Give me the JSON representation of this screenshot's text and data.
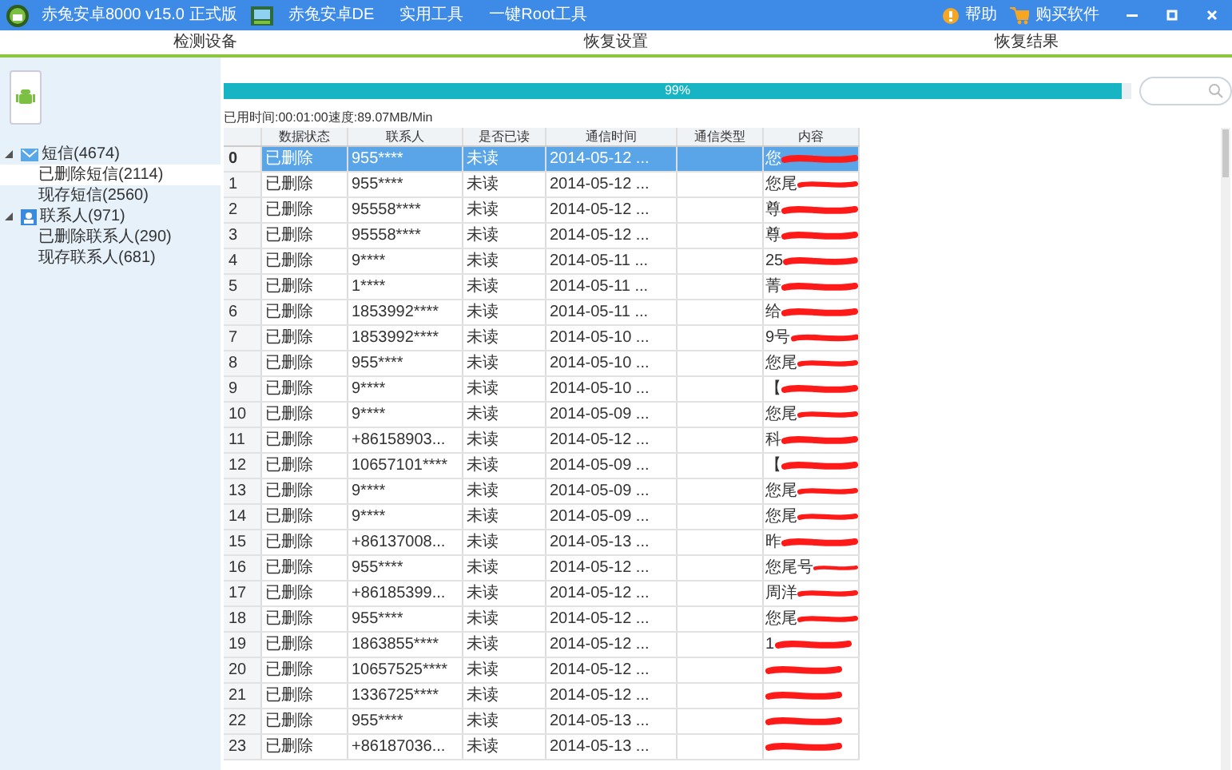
{
  "title_bar": {
    "app_title": "赤兔安卓8000 v15.0 正式版",
    "menu": [
      "赤兔安卓DE",
      "实用工具",
      "一键Root工具"
    ],
    "help": "帮助",
    "buy": "购买软件"
  },
  "tabs": [
    {
      "label": "检测设备",
      "selected": false
    },
    {
      "label": "恢复设置",
      "selected": false
    },
    {
      "label": "恢复结果",
      "selected": false
    }
  ],
  "sidebar": {
    "tree": [
      {
        "label": "短信(4674)",
        "kind": "sms",
        "expanded": true,
        "selected": false,
        "children": [
          {
            "label": "已删除短信(2114)",
            "selected": true
          },
          {
            "label": "现存短信(2560)",
            "selected": false
          }
        ]
      },
      {
        "label": "联系人(971)",
        "kind": "contacts",
        "expanded": true,
        "selected": false,
        "children": [
          {
            "label": "已删除联系人(290)",
            "selected": false
          },
          {
            "label": "现存联系人(681)",
            "selected": false
          }
        ]
      }
    ]
  },
  "progress": {
    "level": 0.99,
    "label": "99%"
  },
  "status_text": "已用时间:00:01:00速度:89.07MB/Min",
  "table": {
    "columns": [
      "数据状态",
      "联系人",
      "是否已读",
      "通信时间",
      "通信类型",
      "内容"
    ],
    "rows": [
      {
        "index": "0",
        "status": "已删除",
        "contact": "955****",
        "read": "未读",
        "time": "2014-05-12 ...",
        "content": "您",
        "selected": true
      },
      {
        "index": "1",
        "status": "已删除",
        "contact": "955****",
        "read": "未读",
        "time": "2014-05-12 ...",
        "content": "您尾",
        "selected": false
      },
      {
        "index": "2",
        "status": "已删除",
        "contact": "95558****",
        "read": "未读",
        "time": "2014-05-12 ...",
        "content": "尊",
        "selected": false
      },
      {
        "index": "3",
        "status": "已删除",
        "contact": "95558****",
        "read": "未读",
        "time": "2014-05-12 ...",
        "content": "尊",
        "selected": false
      },
      {
        "index": "4",
        "status": "已删除",
        "contact": "9****",
        "read": "未读",
        "time": "2014-05-11 ...",
        "content": "25",
        "selected": false
      },
      {
        "index": "5",
        "status": "已删除",
        "contact": "1****",
        "read": "未读",
        "time": "2014-05-11 ...",
        "content": "菁",
        "selected": false
      },
      {
        "index": "6",
        "status": "已删除",
        "contact": "1853992****",
        "read": "未读",
        "time": "2014-05-11 ...",
        "content": "给",
        "selected": false
      },
      {
        "index": "7",
        "status": "已删除",
        "contact": "1853992****",
        "read": "未读",
        "time": "2014-05-10 ...",
        "content": "9号",
        "selected": false
      },
      {
        "index": "8",
        "status": "已删除",
        "contact": "955****",
        "read": "未读",
        "time": "2014-05-10 ...",
        "content": "您尾",
        "selected": false
      },
      {
        "index": "9",
        "status": "已删除",
        "contact": "9****",
        "read": "未读",
        "time": "2014-05-10 ...",
        "content": "【",
        "selected": false
      },
      {
        "index": "10",
        "status": "已删除",
        "contact": "9****",
        "read": "未读",
        "time": "2014-05-09 ...",
        "content": "您尾",
        "selected": false
      },
      {
        "index": "11",
        "status": "已删除",
        "contact": "+86158903...",
        "read": "未读",
        "time": "2014-05-12 ...",
        "content": "科",
        "selected": false
      },
      {
        "index": "12",
        "status": "已删除",
        "contact": "10657101****",
        "read": "未读",
        "time": "2014-05-09 ...",
        "content": "【",
        "selected": false
      },
      {
        "index": "13",
        "status": "已删除",
        "contact": "9****",
        "read": "未读",
        "time": "2014-05-09 ...",
        "content": "您尾",
        "selected": false
      },
      {
        "index": "14",
        "status": "已删除",
        "contact": "9****",
        "read": "未读",
        "time": "2014-05-09 ...",
        "content": "您尾",
        "selected": false
      },
      {
        "index": "15",
        "status": "已删除",
        "contact": "+86137008...",
        "read": "未读",
        "time": "2014-05-13 ...",
        "content": "昨",
        "selected": false
      },
      {
        "index": "16",
        "status": "已删除",
        "contact": "955****",
        "read": "未读",
        "time": "2014-05-12 ...",
        "content": "您尾号",
        "selected": false
      },
      {
        "index": "17",
        "status": "已删除",
        "contact": "+86185399...",
        "read": "未读",
        "time": "2014-05-12 ...",
        "content": "周洋",
        "selected": false
      },
      {
        "index": "18",
        "status": "已删除",
        "contact": "955****",
        "read": "未读",
        "time": "2014-05-12 ...",
        "content": "您尾",
        "selected": false
      },
      {
        "index": "19",
        "status": "已删除",
        "contact": "1863855****",
        "read": "未读",
        "time": "2014-05-12 ...",
        "content": "1",
        "selected": false
      },
      {
        "index": "20",
        "status": "已删除",
        "contact": "10657525****",
        "read": "未读",
        "time": "2014-05-12 ...",
        "selected": false
      },
      {
        "index": "21",
        "status": "已删除",
        "contact": "1336725****",
        "read": "未读",
        "time": "2014-05-12 ...",
        "selected": false
      },
      {
        "index": "22",
        "status": "已删除",
        "contact": "955****",
        "read": "未读",
        "time": "2014-05-13 ...",
        "selected": false
      },
      {
        "index": "23",
        "status": "已删除",
        "contact": "+86187036...",
        "read": "未读",
        "time": "2014-05-13 ...",
        "selected": false
      }
    ]
  }
}
